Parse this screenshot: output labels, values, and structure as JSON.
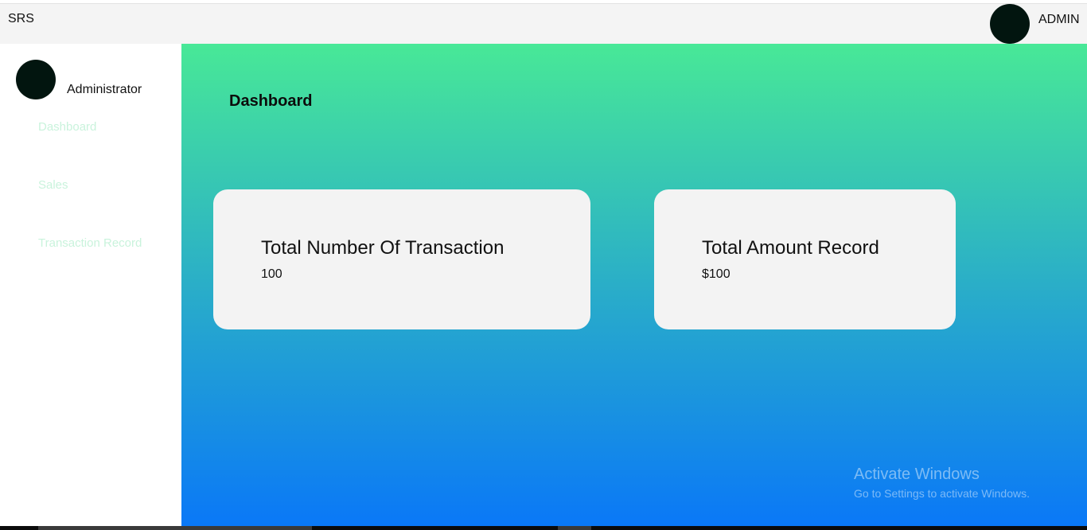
{
  "header": {
    "brand": "SRS",
    "user_label": "ADMIN",
    "avatar_icon": "user-avatar-icon"
  },
  "sidebar": {
    "profile_name": "Administrator",
    "items": [
      {
        "label": "Dashboard"
      },
      {
        "label": "Sales"
      },
      {
        "label": "Transaction Record"
      }
    ]
  },
  "main": {
    "title": "Dashboard",
    "cards": [
      {
        "title": "Total Number Of Transaction",
        "value": "100"
      },
      {
        "title": "Total Amount Record",
        "value": "$100"
      }
    ]
  },
  "watermark": {
    "title": "Activate Windows",
    "subtitle": "Go to Settings to activate Windows."
  },
  "colors": {
    "avatar": "#02150f",
    "nav_text": "#c9f3dc",
    "gradient_top": "#48e897",
    "gradient_bottom": "#0a78f7",
    "card_bg": "#f3f3f3"
  }
}
